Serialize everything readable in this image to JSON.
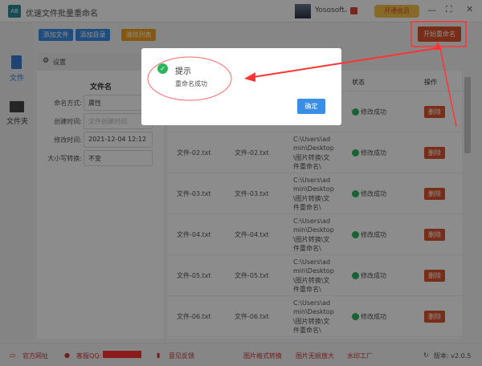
{
  "app": {
    "title": "优速文件批量重命名",
    "user": "Yososoft",
    "vip": "开通会员"
  },
  "toolbar": {
    "add_file": "添加文件",
    "add_dir": "添加目录",
    "clear": "清除列表",
    "start": "开始重命名"
  },
  "sidebar": [
    {
      "label": "文件"
    },
    {
      "label": "文件夹"
    }
  ],
  "settings": {
    "title": "设置",
    "section": "文件名",
    "fields": [
      {
        "label": "命名方式:",
        "value": "属性"
      },
      {
        "label": "创建时间:",
        "value": "文件创建时间"
      },
      {
        "label": "修改时间:",
        "value": "2021-12-04 12:12"
      },
      {
        "label": "大小写转换:",
        "value": "不变"
      }
    ]
  },
  "table": {
    "headers": {
      "status": "状态",
      "action": "操作"
    },
    "rows": [
      {
        "orig": "",
        "new": "",
        "path": [
          "",
          "",
          "",
          "件重命名\\"
        ],
        "status": "修改成功",
        "action": "删除"
      },
      {
        "orig": "文件-02.txt",
        "new": "文件-02.txt",
        "path": [
          "C:\\Users\\ad",
          "min\\Desktop",
          "\\图片转换\\文",
          "件重命名\\"
        ],
        "status": "修改成功",
        "action": "删除"
      },
      {
        "orig": "文件-03.txt",
        "new": "文件-03.txt",
        "path": [
          "C:\\Users\\ad",
          "min\\Desktop",
          "\\图片转换\\文",
          "件重命名\\"
        ],
        "status": "修改成功",
        "action": "删除"
      },
      {
        "orig": "文件-04.txt",
        "new": "文件-04.txt",
        "path": [
          "C:\\Users\\ad",
          "min\\Desktop",
          "\\图片转换\\文",
          "件重命名\\"
        ],
        "status": "修改成功",
        "action": "删除"
      },
      {
        "orig": "文件-05.txt",
        "new": "文件-05.txt",
        "path": [
          "C:\\Users\\ad",
          "min\\Desktop",
          "\\图片转换\\文",
          "件重命名\\"
        ],
        "status": "修改成功",
        "action": "删除"
      },
      {
        "orig": "文件-06.txt",
        "new": "文件-06.txt",
        "path": [
          "C:\\Users\\ad",
          "min\\Desktop",
          "\\图片转换\\文",
          "件重命名\\"
        ],
        "status": "修改成功",
        "action": "删除"
      }
    ]
  },
  "footer": {
    "website": "官方网址",
    "qq": "客服QQ:",
    "feedback": "意见反馈",
    "link1": "图片格式转换",
    "link2": "图片无损放大",
    "link3": "水印工厂",
    "version": "版本: v2.0.5"
  },
  "dialog": {
    "title": "提示",
    "message": "重命名成功",
    "confirm": "确定"
  },
  "colors": {
    "primary": "#3a8ee6",
    "danger": "#d9532b",
    "warning": "#f0a020",
    "success": "#2db55d",
    "annotation": "#ff3333"
  }
}
